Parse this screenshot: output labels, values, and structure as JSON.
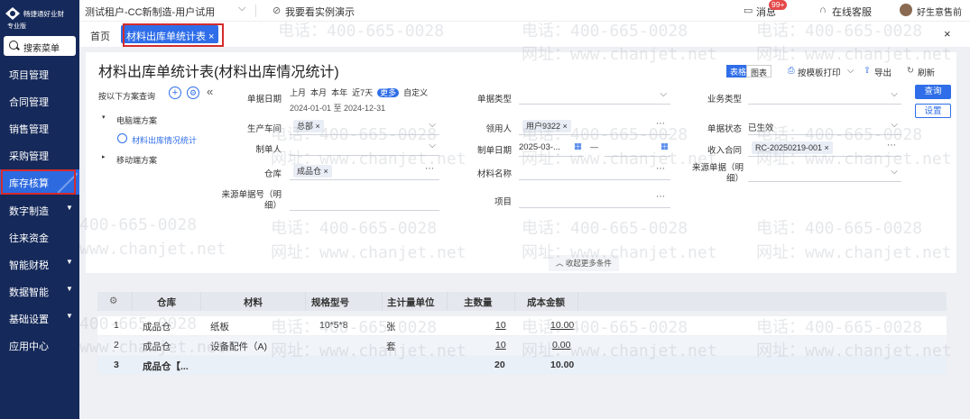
{
  "brand": {
    "name": "畅捷通好业财",
    "edition": "专业版"
  },
  "topbar": {
    "account": "测试租户-CC新制造-用户试用",
    "demo": "我要看实例演示",
    "message": "消息",
    "badge": "99+",
    "service": "在线客服",
    "user": "好生意售前"
  },
  "sidebar": {
    "search": "搜索菜单",
    "items": [
      {
        "label": "项目管理",
        "caret": ""
      },
      {
        "label": "合同管理",
        "caret": ""
      },
      {
        "label": "销售管理",
        "caret": ""
      },
      {
        "label": "采购管理",
        "caret": ""
      },
      {
        "label": "库存核算",
        "caret": ""
      },
      {
        "label": "数字制造",
        "caret": "▼"
      },
      {
        "label": "往来资金",
        "caret": ""
      },
      {
        "label": "智能财税",
        "caret": "▼"
      },
      {
        "label": "数据智能",
        "caret": "▼"
      },
      {
        "label": "基础设置",
        "caret": "▼"
      },
      {
        "label": "应用中心",
        "caret": ""
      }
    ]
  },
  "tabs": {
    "home": "首页",
    "active": "材料出库单统计表 ×",
    "close": "×"
  },
  "page": {
    "title": "材料出库单统计表(材料出库情况统计)",
    "view_table": "表格",
    "view_chart": "图表",
    "print": "按模板打印",
    "export": "导出",
    "refresh": "刷新"
  },
  "schemes": {
    "query_label": "按以下方案查询",
    "pc": "电脑端方案",
    "pc_item": "材料出库情况统计",
    "mobile": "移动端方案"
  },
  "filters": {
    "date": {
      "label": "单据日期",
      "opts": [
        "上月",
        "本月",
        "本年",
        "近7天",
        "更多",
        "自定义"
      ],
      "range": "2024-01-01 至 2024-12-31"
    },
    "doc_type": {
      "label": "单据类型"
    },
    "biz_type": {
      "label": "业务类型"
    },
    "workshop": {
      "label": "生产车间",
      "chip": "总部 ×"
    },
    "receiver": {
      "label": "领用人",
      "chip": "用户9322 ×"
    },
    "status": {
      "label": "单据状态",
      "value": "已生效"
    },
    "maker": {
      "label": "制单人"
    },
    "make_date": {
      "label": "制单日期",
      "value": "2025-03-...",
      "sep": "—"
    },
    "contract": {
      "label": "收入合同",
      "chip": "RC-20250219-001 ×"
    },
    "warehouse": {
      "label": "仓库",
      "chip": "成品仓 ×"
    },
    "material": {
      "label": "材料名称"
    },
    "source_doc": {
      "label": "来源单据（明细）"
    },
    "source_no": {
      "label": "来源单据号（明细）"
    },
    "project": {
      "label": "项目"
    },
    "query_btn": "查询",
    "settings_btn": "设置",
    "collapse": "收起更多条件"
  },
  "table": {
    "headers": [
      "仓库",
      "材料",
      "规格型号",
      "主计量单位",
      "主数量",
      "成本金额"
    ],
    "rows": [
      {
        "no": "1",
        "warehouse": "成品仓",
        "material": "纸板",
        "spec": "10*5*8",
        "unit": "张",
        "qty": "10",
        "cost": "10.00"
      },
      {
        "no": "2",
        "warehouse": "成品仓",
        "material": "设备配件（A)",
        "spec": "",
        "unit": "套",
        "qty": "10",
        "cost": "0.00"
      }
    ],
    "total": {
      "no": "3",
      "warehouse": "成品仓【...",
      "qty": "20",
      "cost": "10.00"
    }
  },
  "watermark": {
    "phone": "电话：400-665-0028",
    "site": "网址：www.chanjet.net",
    "phone_short": "400-665-0028",
    "site_short": "www.chanjet.net"
  },
  "colors": {
    "sidebar": "#15295a",
    "accent": "#2f6ee8",
    "highlight_box": "#d62b2b"
  }
}
